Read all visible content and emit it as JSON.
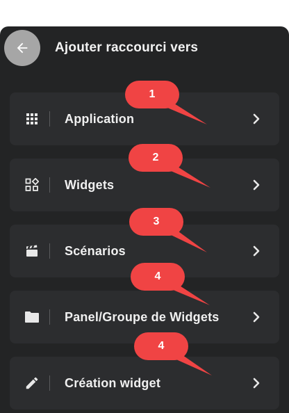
{
  "header": {
    "title": "Ajouter raccourci vers",
    "back_icon": "arrow-left-icon"
  },
  "items": [
    {
      "label": "Application",
      "icon": "apps-grid-icon"
    },
    {
      "label": "Widgets",
      "icon": "widgets-icon"
    },
    {
      "label": "Scénarios",
      "icon": "clapperboard-icon"
    },
    {
      "label": "Panel/Groupe de Widgets",
      "icon": "folder-icon"
    },
    {
      "label": "Création widget",
      "icon": "pencil-icon"
    }
  ],
  "callouts": [
    {
      "number": "1"
    },
    {
      "number": "2"
    },
    {
      "number": "3"
    },
    {
      "number": "4"
    },
    {
      "number": "4"
    }
  ],
  "colors": {
    "panel_background": "#232425",
    "item_background": "#2c2d2f",
    "text": "#f0f0f0",
    "callout_fill": "#f04444",
    "back_button": "#a6a6a6"
  }
}
